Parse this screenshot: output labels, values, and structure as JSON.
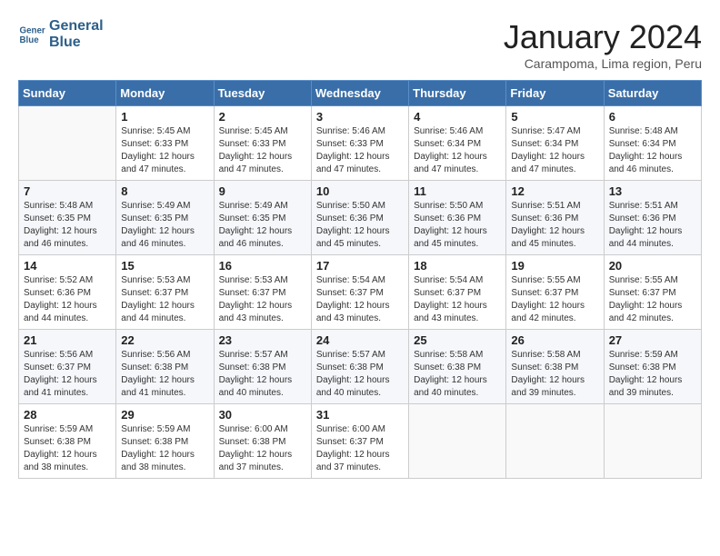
{
  "logo": {
    "line1": "General",
    "line2": "Blue"
  },
  "title": "January 2024",
  "subtitle": "Carampoma, Lima region, Peru",
  "weekdays": [
    "Sunday",
    "Monday",
    "Tuesday",
    "Wednesday",
    "Thursday",
    "Friday",
    "Saturday"
  ],
  "weeks": [
    [
      {
        "day": "",
        "info": ""
      },
      {
        "day": "1",
        "info": "Sunrise: 5:45 AM\nSunset: 6:33 PM\nDaylight: 12 hours\nand 47 minutes."
      },
      {
        "day": "2",
        "info": "Sunrise: 5:45 AM\nSunset: 6:33 PM\nDaylight: 12 hours\nand 47 minutes."
      },
      {
        "day": "3",
        "info": "Sunrise: 5:46 AM\nSunset: 6:33 PM\nDaylight: 12 hours\nand 47 minutes."
      },
      {
        "day": "4",
        "info": "Sunrise: 5:46 AM\nSunset: 6:34 PM\nDaylight: 12 hours\nand 47 minutes."
      },
      {
        "day": "5",
        "info": "Sunrise: 5:47 AM\nSunset: 6:34 PM\nDaylight: 12 hours\nand 47 minutes."
      },
      {
        "day": "6",
        "info": "Sunrise: 5:48 AM\nSunset: 6:34 PM\nDaylight: 12 hours\nand 46 minutes."
      }
    ],
    [
      {
        "day": "7",
        "info": "Sunrise: 5:48 AM\nSunset: 6:35 PM\nDaylight: 12 hours\nand 46 minutes."
      },
      {
        "day": "8",
        "info": "Sunrise: 5:49 AM\nSunset: 6:35 PM\nDaylight: 12 hours\nand 46 minutes."
      },
      {
        "day": "9",
        "info": "Sunrise: 5:49 AM\nSunset: 6:35 PM\nDaylight: 12 hours\nand 46 minutes."
      },
      {
        "day": "10",
        "info": "Sunrise: 5:50 AM\nSunset: 6:36 PM\nDaylight: 12 hours\nand 45 minutes."
      },
      {
        "day": "11",
        "info": "Sunrise: 5:50 AM\nSunset: 6:36 PM\nDaylight: 12 hours\nand 45 minutes."
      },
      {
        "day": "12",
        "info": "Sunrise: 5:51 AM\nSunset: 6:36 PM\nDaylight: 12 hours\nand 45 minutes."
      },
      {
        "day": "13",
        "info": "Sunrise: 5:51 AM\nSunset: 6:36 PM\nDaylight: 12 hours\nand 44 minutes."
      }
    ],
    [
      {
        "day": "14",
        "info": "Sunrise: 5:52 AM\nSunset: 6:36 PM\nDaylight: 12 hours\nand 44 minutes."
      },
      {
        "day": "15",
        "info": "Sunrise: 5:53 AM\nSunset: 6:37 PM\nDaylight: 12 hours\nand 44 minutes."
      },
      {
        "day": "16",
        "info": "Sunrise: 5:53 AM\nSunset: 6:37 PM\nDaylight: 12 hours\nand 43 minutes."
      },
      {
        "day": "17",
        "info": "Sunrise: 5:54 AM\nSunset: 6:37 PM\nDaylight: 12 hours\nand 43 minutes."
      },
      {
        "day": "18",
        "info": "Sunrise: 5:54 AM\nSunset: 6:37 PM\nDaylight: 12 hours\nand 43 minutes."
      },
      {
        "day": "19",
        "info": "Sunrise: 5:55 AM\nSunset: 6:37 PM\nDaylight: 12 hours\nand 42 minutes."
      },
      {
        "day": "20",
        "info": "Sunrise: 5:55 AM\nSunset: 6:37 PM\nDaylight: 12 hours\nand 42 minutes."
      }
    ],
    [
      {
        "day": "21",
        "info": "Sunrise: 5:56 AM\nSunset: 6:37 PM\nDaylight: 12 hours\nand 41 minutes."
      },
      {
        "day": "22",
        "info": "Sunrise: 5:56 AM\nSunset: 6:38 PM\nDaylight: 12 hours\nand 41 minutes."
      },
      {
        "day": "23",
        "info": "Sunrise: 5:57 AM\nSunset: 6:38 PM\nDaylight: 12 hours\nand 40 minutes."
      },
      {
        "day": "24",
        "info": "Sunrise: 5:57 AM\nSunset: 6:38 PM\nDaylight: 12 hours\nand 40 minutes."
      },
      {
        "day": "25",
        "info": "Sunrise: 5:58 AM\nSunset: 6:38 PM\nDaylight: 12 hours\nand 40 minutes."
      },
      {
        "day": "26",
        "info": "Sunrise: 5:58 AM\nSunset: 6:38 PM\nDaylight: 12 hours\nand 39 minutes."
      },
      {
        "day": "27",
        "info": "Sunrise: 5:59 AM\nSunset: 6:38 PM\nDaylight: 12 hours\nand 39 minutes."
      }
    ],
    [
      {
        "day": "28",
        "info": "Sunrise: 5:59 AM\nSunset: 6:38 PM\nDaylight: 12 hours\nand 38 minutes."
      },
      {
        "day": "29",
        "info": "Sunrise: 5:59 AM\nSunset: 6:38 PM\nDaylight: 12 hours\nand 38 minutes."
      },
      {
        "day": "30",
        "info": "Sunrise: 6:00 AM\nSunset: 6:38 PM\nDaylight: 12 hours\nand 37 minutes."
      },
      {
        "day": "31",
        "info": "Sunrise: 6:00 AM\nSunset: 6:37 PM\nDaylight: 12 hours\nand 37 minutes."
      },
      {
        "day": "",
        "info": ""
      },
      {
        "day": "",
        "info": ""
      },
      {
        "day": "",
        "info": ""
      }
    ]
  ]
}
